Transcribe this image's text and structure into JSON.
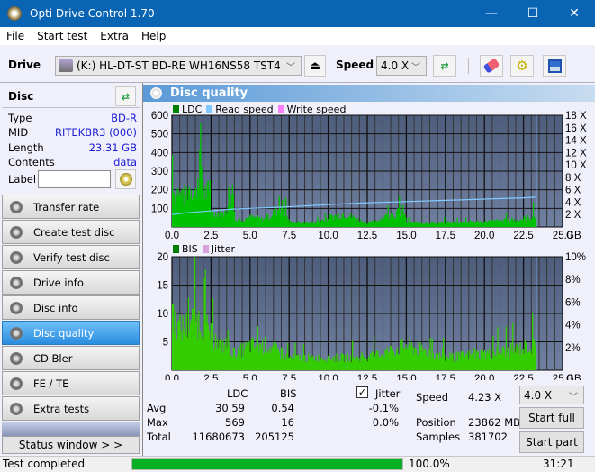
{
  "window": {
    "title": "Opti Drive Control 1.70",
    "minimize": "—",
    "maximize": "☐",
    "close": "✕"
  },
  "menu": [
    "File",
    "Start test",
    "Extra",
    "Help"
  ],
  "toolbar": {
    "drive_label": "Drive",
    "drive_value": "(K:)  HL-DT-ST BD-RE  WH16NS58 TST4",
    "speed_label": "Speed",
    "speed_value": "4.0 X"
  },
  "disc": {
    "header": "Disc",
    "rows": [
      {
        "label": "Type",
        "value": "BD-R"
      },
      {
        "label": "MID",
        "value": "RITEKBR3 (000)"
      },
      {
        "label": "Length",
        "value": "23.31 GB"
      },
      {
        "label": "Contents",
        "value": "data"
      }
    ],
    "label_field_label": "Label",
    "label_field_value": ""
  },
  "nav": [
    {
      "label": "Transfer rate",
      "active": false
    },
    {
      "label": "Create test disc",
      "active": false
    },
    {
      "label": "Verify test disc",
      "active": false
    },
    {
      "label": "Drive info",
      "active": false
    },
    {
      "label": "Disc info",
      "active": false
    },
    {
      "label": "Disc quality",
      "active": true
    },
    {
      "label": "CD Bler",
      "active": false
    },
    {
      "label": "FE / TE",
      "active": false
    },
    {
      "label": "Extra tests",
      "active": false
    }
  ],
  "status_window_button": "Status window > >",
  "panel_title": "Disc quality",
  "colors": {
    "ldc": "#00c000",
    "read_speed": "#80c8ff",
    "write_speed": "#ff80ff",
    "bis": "#00c000",
    "jitter": "#d8a0d8",
    "plot_bg_top": "#4e5d7c",
    "plot_bg_bottom": "#7080a0",
    "value_blue": "#1a1ad4"
  },
  "chart_data": [
    {
      "type": "bar",
      "title": "LDC / Read speed",
      "legend": [
        "LDC",
        "Read speed",
        "Write speed"
      ],
      "xlabel": "GB",
      "x_ticks": [
        "0.0",
        "2.5",
        "5.0",
        "7.5",
        "10.0",
        "12.5",
        "15.0",
        "17.5",
        "20.0",
        "22.5",
        "25.0"
      ],
      "xlim": [
        0,
        25
      ],
      "y_ticks": [
        "100",
        "200",
        "300",
        "400",
        "500",
        "600"
      ],
      "ylim": [
        0,
        600
      ],
      "y2_ticks": [
        "2 X",
        "4 X",
        "6 X",
        "8 X",
        "10 X",
        "12 X",
        "14 X",
        "16 X",
        "18 X"
      ],
      "y2lim": [
        0,
        18
      ],
      "ldc_profile": [
        [
          0,
          540
        ],
        [
          0.1,
          250
        ],
        [
          0.3,
          270
        ],
        [
          0.6,
          200
        ],
        [
          1.0,
          280
        ],
        [
          1.2,
          310
        ],
        [
          1.5,
          240
        ],
        [
          1.8,
          569
        ],
        [
          2.0,
          250
        ],
        [
          2.3,
          260
        ],
        [
          2.5,
          110
        ],
        [
          3.0,
          100
        ],
        [
          3.5,
          90
        ],
        [
          3.8,
          310
        ],
        [
          4.0,
          50
        ],
        [
          4.5,
          60
        ],
        [
          5.0,
          70
        ],
        [
          6.0,
          55
        ],
        [
          7.0,
          160
        ],
        [
          7.5,
          35
        ],
        [
          9.0,
          30
        ],
        [
          11.0,
          100
        ],
        [
          12.5,
          25
        ],
        [
          14.8,
          120
        ],
        [
          15.0,
          30
        ],
        [
          17.5,
          30
        ],
        [
          20.0,
          40
        ],
        [
          22.0,
          50
        ],
        [
          23.3,
          80
        ]
      ],
      "read_speed": [
        [
          0,
          2.0
        ],
        [
          1,
          2.3
        ],
        [
          2,
          2.5
        ],
        [
          3,
          2.7
        ],
        [
          4,
          2.9
        ],
        [
          5,
          3.0
        ],
        [
          7,
          3.2
        ],
        [
          10,
          3.6
        ],
        [
          12.5,
          3.9
        ],
        [
          15,
          4.1
        ],
        [
          17.5,
          4.3
        ],
        [
          20,
          4.5
        ],
        [
          22.5,
          4.7
        ],
        [
          23.3,
          4.8
        ]
      ],
      "end_marker_gb": 23.31
    },
    {
      "type": "bar",
      "title": "BIS / Jitter",
      "legend": [
        "BIS",
        "Jitter"
      ],
      "xlabel": "GB",
      "x_ticks": [
        "0.0",
        "2.5",
        "5.0",
        "7.5",
        "10.0",
        "12.5",
        "15.0",
        "17.5",
        "20.0",
        "22.5",
        "25.0"
      ],
      "xlim": [
        0,
        25
      ],
      "y_ticks": [
        "5",
        "10",
        "15",
        "20"
      ],
      "ylim": [
        0,
        20
      ],
      "y2_ticks": [
        "2%",
        "4%",
        "6%",
        "8%",
        "10%"
      ],
      "y2lim": [
        0,
        10
      ],
      "bis_profile": [
        [
          0,
          16
        ],
        [
          0.2,
          11
        ],
        [
          0.5,
          10
        ],
        [
          1.0,
          11
        ],
        [
          1.3,
          12
        ],
        [
          1.8,
          12
        ],
        [
          2.2,
          10
        ],
        [
          2.5,
          8
        ],
        [
          3.0,
          6
        ],
        [
          3.5,
          6
        ],
        [
          4.0,
          4
        ],
        [
          5.0,
          6
        ],
        [
          6.0,
          6
        ],
        [
          7.0,
          4
        ],
        [
          7.5,
          3
        ],
        [
          9.0,
          3
        ],
        [
          12.5,
          3
        ],
        [
          15.0,
          6
        ],
        [
          17.5,
          3
        ],
        [
          20.0,
          4
        ],
        [
          22.0,
          5
        ],
        [
          23.3,
          6
        ]
      ],
      "end_marker_gb": 23.31
    }
  ],
  "stats": {
    "headers": {
      "ldc": "LDC",
      "bis": "BIS",
      "jitter": "Jitter"
    },
    "jitter_checked": true,
    "rows": [
      {
        "label": "Avg",
        "ldc": "30.59",
        "bis": "0.54",
        "jitter": "-0.1%"
      },
      {
        "label": "Max",
        "ldc": "569",
        "bis": "16",
        "jitter": "0.0%"
      },
      {
        "label": "Total",
        "ldc": "11680673",
        "bis": "205125",
        "jitter": ""
      }
    ],
    "speed_label": "Speed",
    "speed_value": "4.23 X",
    "position_label": "Position",
    "position_value": "23862 MB",
    "samples_label": "Samples",
    "samples_value": "381702",
    "speed_select": "4.0 X",
    "start_full": "Start full",
    "start_part": "Start part"
  },
  "statusbar": {
    "text": "Test completed",
    "progress": 100,
    "progress_text": "100.0%",
    "time": "31:21"
  }
}
